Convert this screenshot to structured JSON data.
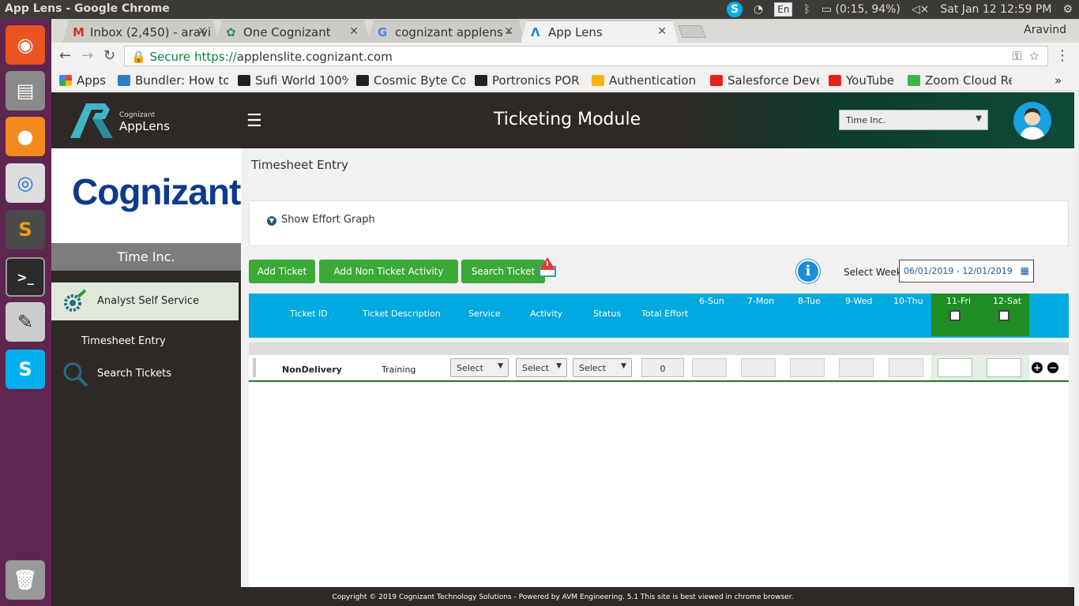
{
  "os": {
    "window_title": "App Lens - Google Chrome",
    "battery": "(0:15, 94%)",
    "datetime": "Sat Jan 12 12:59 PM",
    "lang": "En"
  },
  "browser": {
    "tabs": [
      {
        "label": "Inbox (2,450) - aravi",
        "icon": "gmail-icon"
      },
      {
        "label": "One Cognizant",
        "icon": "onecognizant-icon"
      },
      {
        "label": "cognizant applens -",
        "icon": "google-icon"
      },
      {
        "label": "App Lens",
        "icon": "applens-icon"
      }
    ],
    "profile": "Aravind",
    "secure_label": "Secure",
    "url_proto": "https://",
    "url_host": "applenslite.cognizant.com",
    "bookmarks": [
      "Apps",
      "Bundler: How to",
      "Sufi World 100%",
      "Cosmic Byte Co",
      "Portronics POR",
      "Authentication",
      "Salesforce Deve",
      "YouTube",
      "Zoom Cloud Rec"
    ]
  },
  "app": {
    "logo_small": "Cognizant",
    "logo_big": "AppLens",
    "module_title": "Ticketing Module",
    "client_select": "Time Inc.",
    "brand": "Cognizant",
    "client_band": "Time Inc.",
    "nav": {
      "active": "Analyst Self Service",
      "items": [
        "Timesheet Entry",
        "Search Tickets"
      ]
    }
  },
  "page": {
    "title": "Timesheet Entry",
    "effort_toggle": "Show Effort Graph",
    "buttons": {
      "add_ticket": "Add Ticket",
      "add_non_ticket": "Add Non Ticket Activity",
      "search_ticket": "Search Ticket"
    },
    "week_label": "Select Week:",
    "week_value": "06/01/2019 - 12/01/2019",
    "grid": {
      "headers": [
        "Ticket ID",
        "Ticket Description",
        "Service",
        "Activity",
        "Status",
        "Total Effort"
      ],
      "days": [
        "6-Sun",
        "7-Mon",
        "8-Tue",
        "9-Wed",
        "10-Thu",
        "11-Fri",
        "12-Sat"
      ],
      "row": {
        "ticket_id": "NonDelivery",
        "description": "Training",
        "service": "Select",
        "activity": "Select",
        "status": "Select",
        "total_effort": "0"
      }
    }
  },
  "footer": "Copyright © 2019 Cognizant Technology Solutions - Powered by AVM Engineering. 5.1 This site is best viewed in chrome browser."
}
